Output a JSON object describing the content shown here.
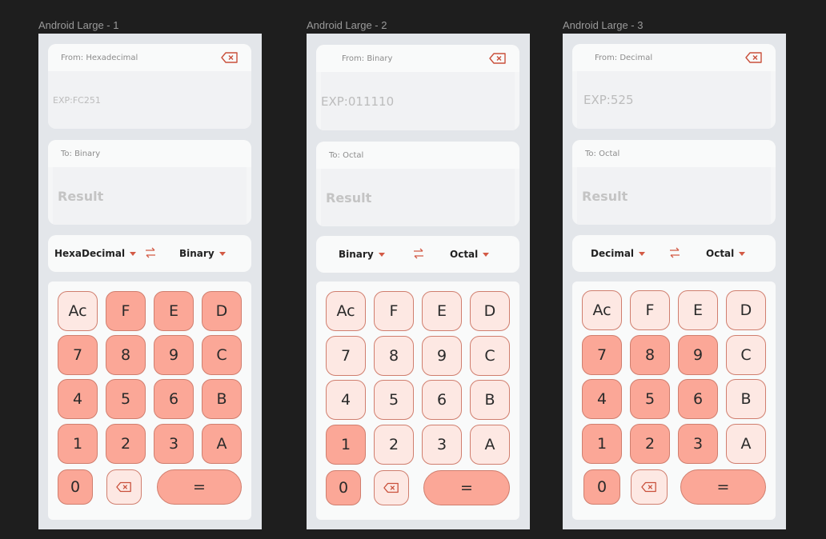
{
  "frames": [
    {
      "title": "Android Large - 1",
      "from_label": "From: Hexadecimal",
      "input_placeholder": "EXP:FC251",
      "to_label": "To: Binary",
      "result_placeholder": "Result",
      "from_select": "HexaDecimal",
      "to_select": "Binary",
      "keys": [
        "Ac",
        "F",
        "E",
        "D",
        "7",
        "8",
        "9",
        "C",
        "4",
        "5",
        "6",
        "B",
        "1",
        "2",
        "3",
        "A",
        "0",
        "="
      ]
    },
    {
      "title": "Android Large - 2",
      "from_label": "From: Binary",
      "input_placeholder": "EXP:011110",
      "to_label": "To: Octal",
      "result_placeholder": "Result",
      "from_select": "Binary",
      "to_select": "Octal",
      "keys": [
        "Ac",
        "F",
        "E",
        "D",
        "7",
        "8",
        "9",
        "C",
        "4",
        "5",
        "6",
        "B",
        "1",
        "2",
        "3",
        "A",
        "0",
        "="
      ]
    },
    {
      "title": "Android Large - 3",
      "from_label": "From: Decimal",
      "input_placeholder": "EXP:525",
      "to_label": "To: Octal",
      "result_placeholder": "Result",
      "from_select": "Decimal",
      "to_select": "Octal",
      "keys": [
        "Ac",
        "F",
        "E",
        "D",
        "7",
        "8",
        "9",
        "C",
        "4",
        "5",
        "6",
        "B",
        "1",
        "2",
        "3",
        "A",
        "0",
        "="
      ]
    }
  ],
  "colors": {
    "key_active": "#fba797",
    "key_inactive": "#fde8e3",
    "accent": "#d35a45"
  },
  "icons": [
    "backspace-icon",
    "swap-icon",
    "dropdown-caret-icon"
  ]
}
